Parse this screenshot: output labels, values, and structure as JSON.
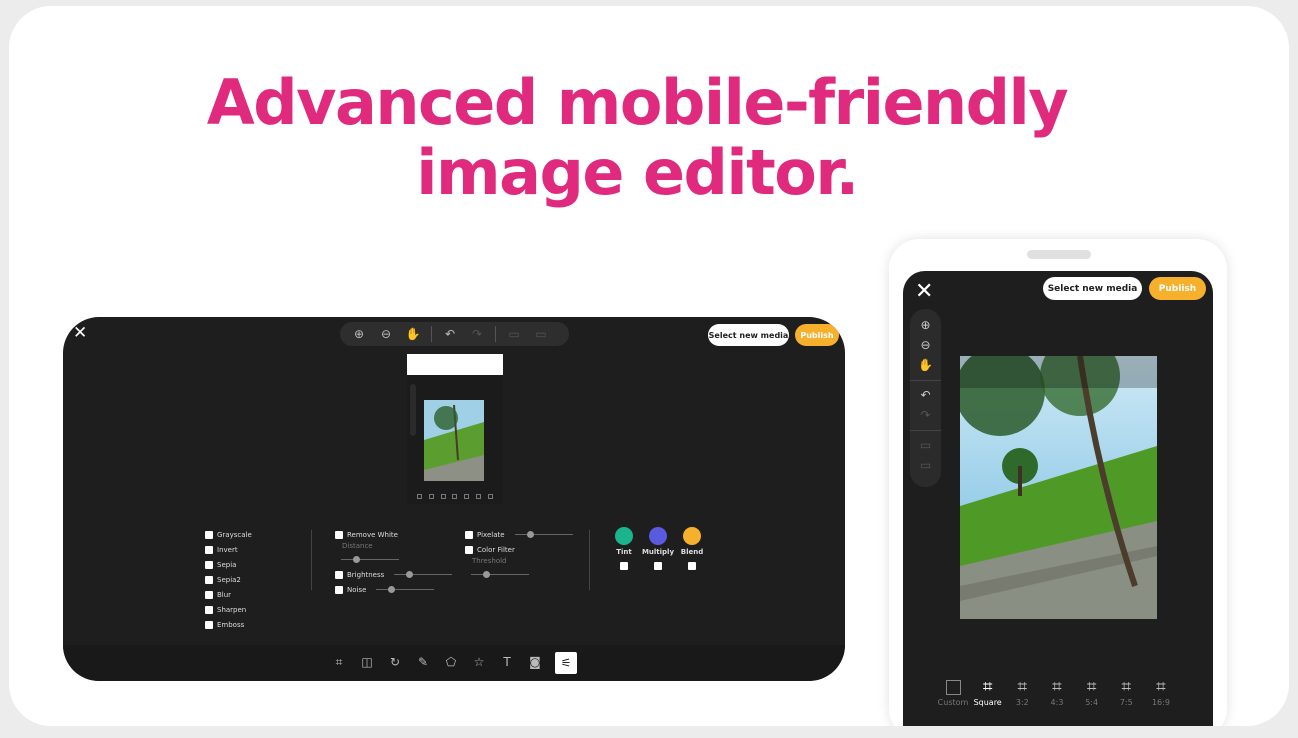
{
  "headline": {
    "line1": "Advanced mobile-friendly",
    "line2": "image editor."
  },
  "desktop": {
    "close_label": "✕",
    "toolbar": [
      "zoom-in-icon",
      "zoom-out-icon",
      "hand-icon",
      "undo-icon",
      "redo-icon",
      "delete-icon",
      "delete-all-icon"
    ],
    "select_media": "Select new media",
    "publish": "Publish",
    "filters_col1": [
      "Grayscale",
      "Invert",
      "Sepia",
      "Sepia2",
      "Blur",
      "Sharpen",
      "Emboss"
    ],
    "filters_col2": {
      "remove_white": "Remove White",
      "distance": "Distance",
      "brightness": "Brightness",
      "noise": "Noise"
    },
    "filters_col3": {
      "pixelate": "Pixelate",
      "color_filter": "Color Filter",
      "threshold": "Threshold"
    },
    "swatches": [
      {
        "label": "Tint",
        "color": "#19b58f"
      },
      {
        "label": "Multiply",
        "color": "#5a5adf"
      },
      {
        "label": "Blend",
        "color": "#f6b02c"
      }
    ],
    "bottom_tools": [
      "crop-icon",
      "flip-icon",
      "rotate-icon",
      "pencil-icon",
      "shape-icon",
      "star-icon",
      "text-icon",
      "frame-icon",
      "filter-icon"
    ]
  },
  "phone": {
    "close_label": "✕",
    "select_media": "Select new media",
    "publish": "Publish",
    "crop_options": [
      "Custom",
      "Square",
      "3:2",
      "4:3",
      "5:4",
      "7:5",
      "16:9"
    ],
    "active_crop": "Square"
  },
  "colors": {
    "brand": "#df2a7e",
    "accent": "#f6b02c",
    "editor_bg": "#1e1e1e"
  }
}
